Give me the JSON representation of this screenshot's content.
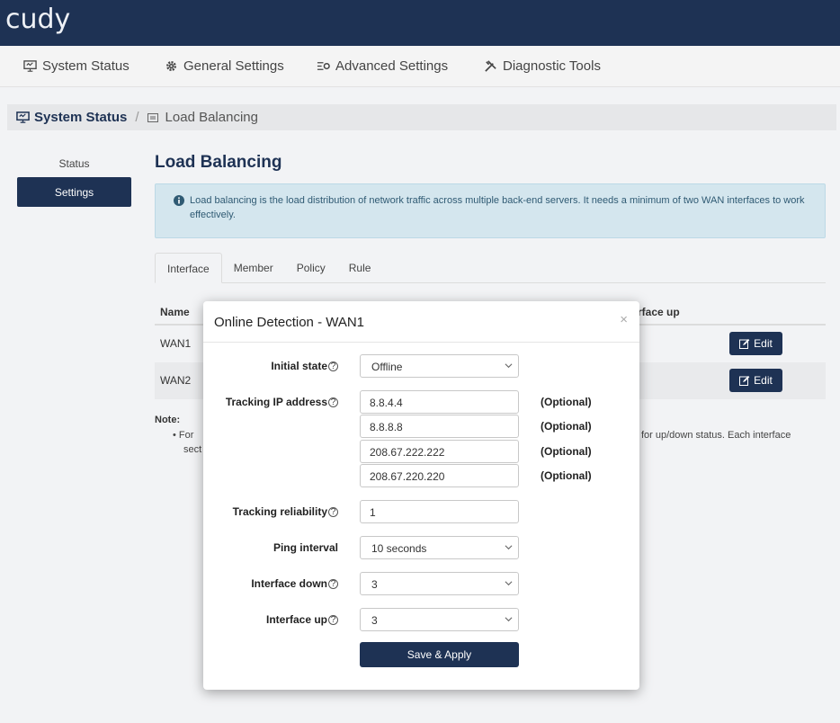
{
  "brand": {
    "logo": "cudy"
  },
  "main_nav": [
    {
      "label": "System Status",
      "icon": "monitor-icon"
    },
    {
      "label": "General Settings",
      "icon": "gear-icon"
    },
    {
      "label": "Advanced Settings",
      "icon": "sliders-icon"
    },
    {
      "label": "Diagnostic Tools",
      "icon": "tools-icon"
    }
  ],
  "breadcrumb": {
    "home": "System Status",
    "separator": "/",
    "current": "Load Balancing"
  },
  "sidebar": {
    "items": [
      {
        "label": "Status"
      },
      {
        "label": "Settings",
        "active": true
      }
    ]
  },
  "page": {
    "title": "Load Balancing",
    "info": "Load balancing is the load distribution of network traffic across multiple back-end servers. It needs a minimum of two WAN interfaces to work effectively.",
    "tabs": [
      "Interface",
      "Member",
      "Policy",
      "Rule"
    ],
    "active_tab": "Interface",
    "table": {
      "headers": {
        "name": "Name",
        "iface_up": "rface up"
      },
      "rows": [
        {
          "name": "WAN1",
          "action": "Edit"
        },
        {
          "name": "WAN2",
          "action": "Edit"
        }
      ]
    },
    "note": {
      "title": "Note:",
      "bullet": "• For",
      "sect": "sect",
      "tail": "for up/down status. Each interface"
    }
  },
  "modal": {
    "title": "Online Detection - WAN1",
    "close": "×",
    "help_glyph": "?",
    "initial_state": {
      "label": "Initial state",
      "value": "Offline"
    },
    "tracking_ip": {
      "label": "Tracking IP address",
      "values": [
        "8.8.4.4",
        "8.8.8.8",
        "208.67.222.222",
        "208.67.220.220"
      ],
      "optional": "(Optional)"
    },
    "tracking_reliability": {
      "label": "Tracking reliability",
      "value": "1"
    },
    "ping_interval": {
      "label": "Ping interval",
      "value": "10 seconds"
    },
    "interface_down": {
      "label": "Interface down",
      "value": "3"
    },
    "interface_up": {
      "label": "Interface up",
      "value": "3"
    },
    "save_label": "Save & Apply"
  },
  "colors": {
    "primary": "#1e3254",
    "info_bg": "#d4e6ee",
    "page_bg": "#f2f3f5"
  }
}
